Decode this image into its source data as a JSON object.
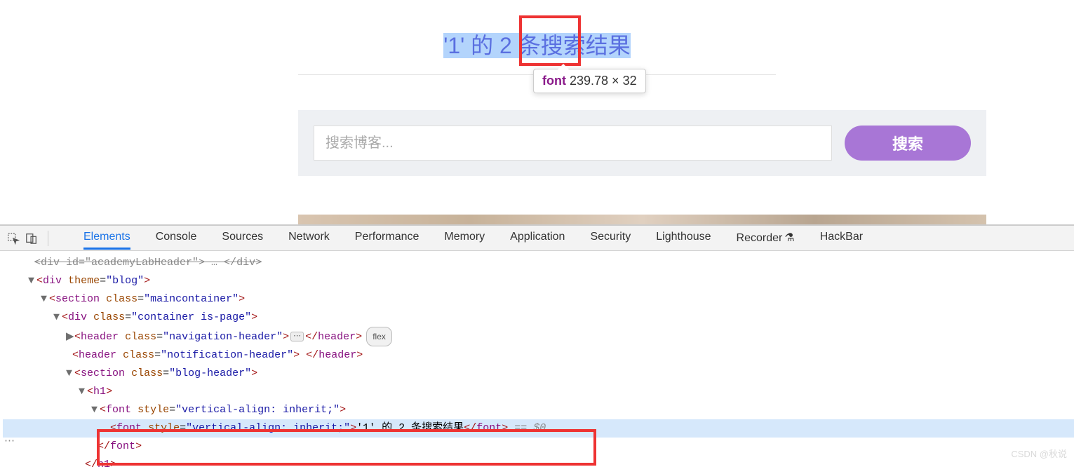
{
  "header": {
    "title_text": "'1' 的 2 条搜索结果",
    "tooltip_name": "font",
    "tooltip_dims": "239.78 × 32"
  },
  "search": {
    "placeholder": "搜索博客...",
    "button_label": "搜索"
  },
  "devtools": {
    "tabs": [
      "Elements",
      "Console",
      "Sources",
      "Network",
      "Performance",
      "Memory",
      "Application",
      "Security",
      "Lighthouse",
      "Recorder",
      "HackBar"
    ],
    "active_tab": "Elements",
    "flex_badge": "flex",
    "dollar_ref": "== $0",
    "dom": {
      "l0": "<div theme=\"blog\">",
      "l1": "<section class=\"maincontainer\">",
      "l2": "<div class=\"container is-page\">",
      "l3_open": "<header class=\"navigation-header\">",
      "l3_close": "</header>",
      "l4": "<header class=\"notification-header\"> </header>",
      "l5": "<section class=\"blog-header\">",
      "l6": "<h1>",
      "l7": "<font style=\"vertical-align: inherit;\">",
      "l8_open": "<font style=\"vertical-align: inherit;\">",
      "l8_text": "'1' 的 2 条搜索结果",
      "l8_close": "</font>",
      "l9": "</font>",
      "l10": "</h1>"
    }
  },
  "watermark": "CSDN @秋说"
}
